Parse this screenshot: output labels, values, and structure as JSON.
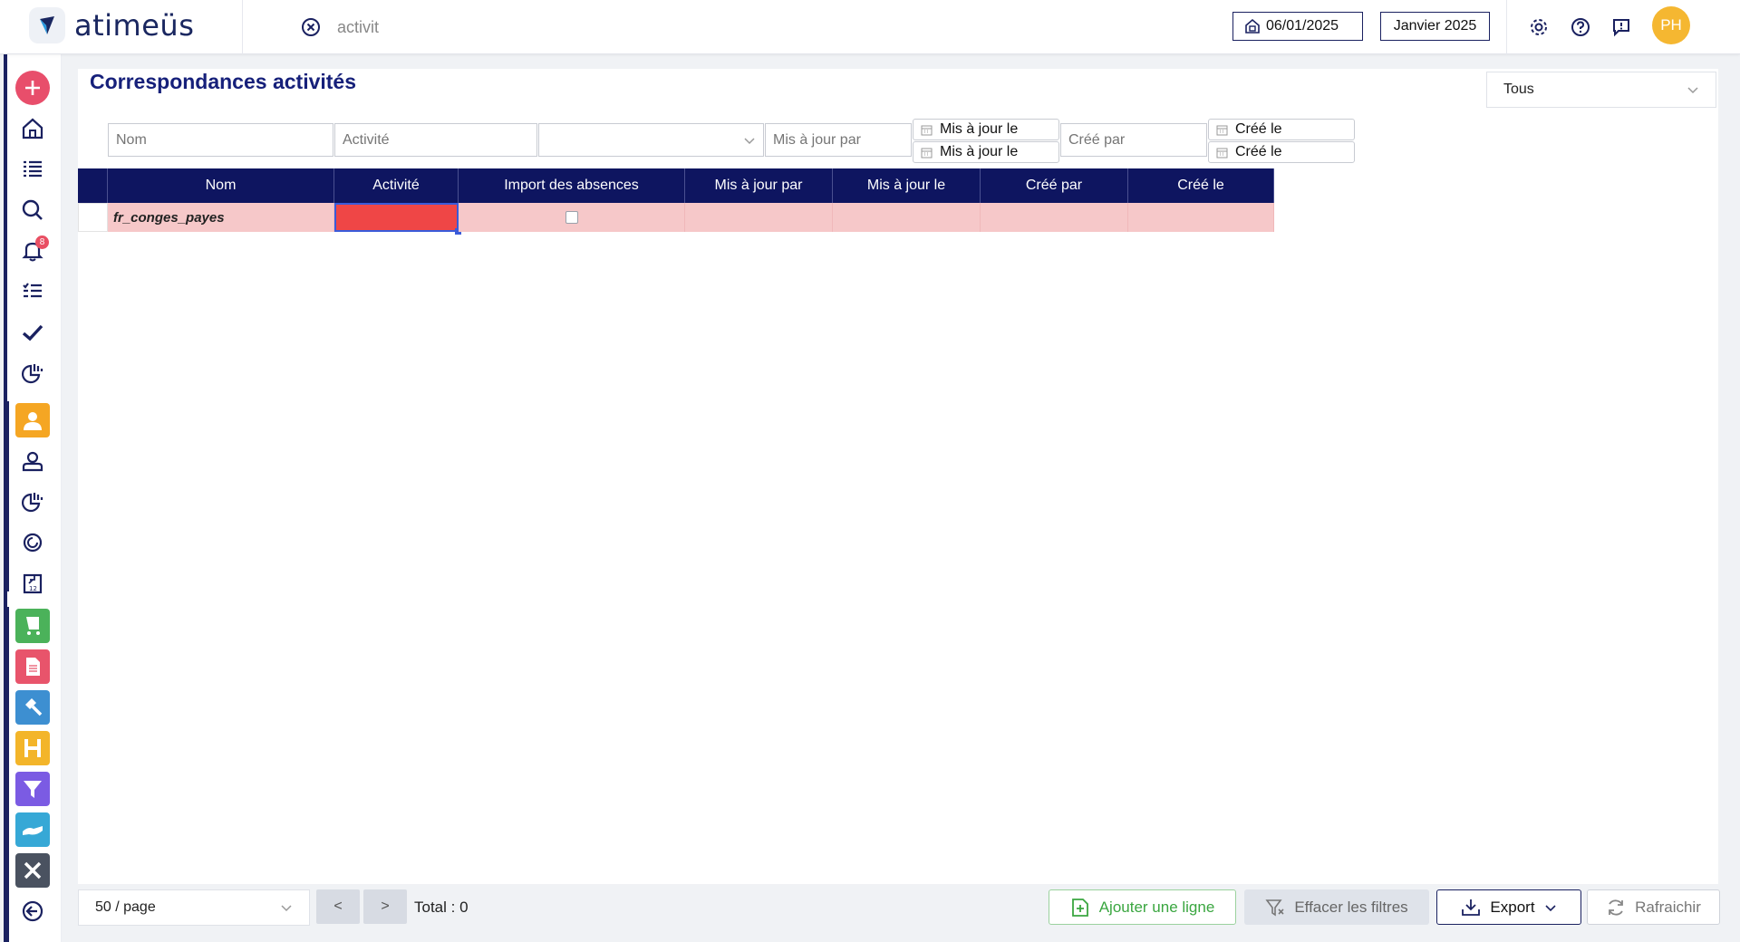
{
  "header": {
    "logo_text": "atimeüs",
    "search_value": "activit",
    "date_value": "06/01/2025",
    "period_value": "Janvier 2025",
    "avatar_initials": "PH"
  },
  "sidebar": {
    "notification_count": "8",
    "items": [
      {
        "name": "add",
        "icon": "plus-icon"
      },
      {
        "name": "home",
        "icon": "home-icon"
      },
      {
        "name": "list",
        "icon": "list-icon"
      },
      {
        "name": "search",
        "icon": "search-icon"
      },
      {
        "name": "notifications",
        "icon": "bell-icon"
      },
      {
        "name": "tasks",
        "icon": "checklist-icon"
      },
      {
        "name": "validations",
        "icon": "check-icon"
      },
      {
        "name": "reports",
        "icon": "chart-icon"
      },
      {
        "name": "employee",
        "icon": "user-icon"
      },
      {
        "name": "employee-profile",
        "icon": "user-outline-icon"
      },
      {
        "name": "employee-reports",
        "icon": "chart-icon"
      },
      {
        "name": "cycles",
        "icon": "cycle-icon"
      },
      {
        "name": "calendar-import",
        "icon": "calendar-icon"
      },
      {
        "name": "expenses",
        "icon": "cart-icon"
      },
      {
        "name": "documents",
        "icon": "document-icon"
      },
      {
        "name": "tools",
        "icon": "hammer-icon"
      },
      {
        "name": "planning",
        "icon": "h-icon"
      },
      {
        "name": "filters",
        "icon": "funnel-icon"
      },
      {
        "name": "handshake",
        "icon": "hand-icon"
      },
      {
        "name": "settings-tools",
        "icon": "wrench-icon"
      },
      {
        "name": "back",
        "icon": "arrow-left-icon"
      }
    ]
  },
  "page": {
    "title": "Correspondances activités",
    "scope_value": "Tous"
  },
  "filters": {
    "nom_placeholder": "Nom",
    "activite_placeholder": "Activité",
    "import_value": "",
    "maj_par_placeholder": "Mis à jour par",
    "maj_le_from": "Mis à jour le",
    "maj_le_to": "Mis à jour le",
    "cree_par_placeholder": "Créé par",
    "cree_le_from": "Créé le",
    "cree_le_to": "Créé le"
  },
  "table": {
    "columns": [
      "Nom",
      "Activité",
      "Import des absences",
      "Mis à jour par",
      "Mis à jour le",
      "Créé par",
      "Créé le"
    ],
    "rows": [
      {
        "nom": "fr_conges_payes",
        "activite": "",
        "import_absences": false,
        "maj_par": "",
        "maj_le": "",
        "cree_par": "",
        "cree_le": ""
      }
    ]
  },
  "footer": {
    "page_size": "50 / page",
    "prev_label": "<",
    "next_label": ">",
    "total_label": "Total : 0",
    "add_label": "Ajouter une ligne",
    "clear_label": "Effacer les filtres",
    "export_label": "Export",
    "refresh_label": "Rafraichir"
  },
  "colors": {
    "brand_navy": "#0e1560",
    "row_error": "#f6c8c9",
    "cell_error": "#ef4646",
    "add_green": "#3aa640"
  }
}
